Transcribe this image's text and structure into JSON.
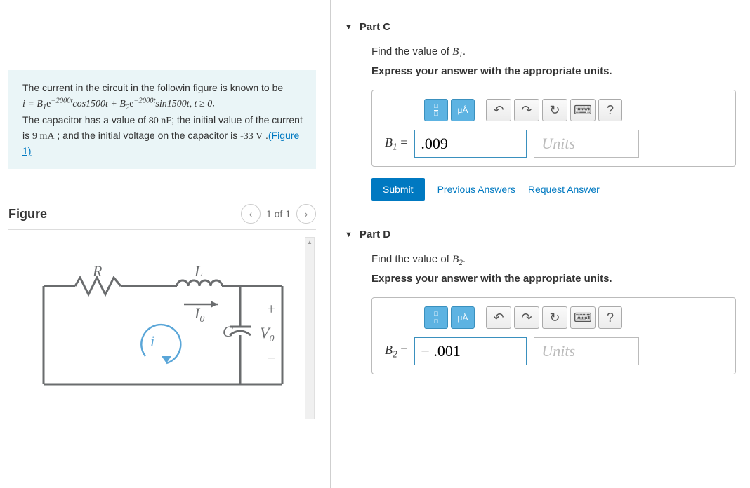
{
  "problem": {
    "intro": "The current in the circuit in the followin figure is known to be",
    "eq_prefix": "i = B",
    "eq_sub1": "1",
    "eq_exp1": "−2000t",
    "eq_cos": "cos1500t + B",
    "eq_sub2": "2",
    "eq_exp2": "−2000t",
    "eq_sin": "sin1500t, t ≥ 0",
    "line2_a": "The capacitor has a value of ",
    "cap_val": "80 nF",
    "line2_b": "; the initial value of the current is ",
    "cur_val": "9 mA",
    "line2_c": " ; and the initial voltage on the capacitor is ",
    "volt_val": "-33 V",
    "line2_d": " .",
    "figure_link": "(Figure 1)"
  },
  "figure": {
    "title": "Figure",
    "nav_text": "1 of 1",
    "labels": {
      "R": "R",
      "L": "L",
      "I0": "I",
      "i": "i",
      "C": "C",
      "V0": "V",
      "plus": "+",
      "minus": "−",
      "zero": "0"
    }
  },
  "partC": {
    "title": "Part C",
    "prompt_a": "Find the value of ",
    "prompt_var": "B",
    "prompt_sub": "1",
    "prompt_b": ".",
    "instruct": "Express your answer with the appropriate units.",
    "var_label_a": "B",
    "var_label_sub": "1",
    "var_label_eq": " = ",
    "value": ".009",
    "units_placeholder": "Units",
    "toolbar": {
      "units": "μÅ",
      "undo": "↶",
      "redo": "↷",
      "reset": "↻",
      "keyboard": "⌨",
      "help": "?"
    },
    "submit": "Submit",
    "prev": "Previous Answers",
    "req": "Request Answer"
  },
  "partD": {
    "title": "Part D",
    "prompt_a": "Find the value of ",
    "prompt_var": "B",
    "prompt_sub": "2",
    "prompt_b": ".",
    "instruct": "Express your answer with the appropriate units.",
    "var_label_a": "B",
    "var_label_sub": "2",
    "var_label_eq": " = ",
    "value": "− .001",
    "units_placeholder": "Units",
    "toolbar": {
      "units": "μÅ",
      "undo": "↶",
      "redo": "↷",
      "reset": "↻",
      "keyboard": "⌨",
      "help": "?"
    }
  }
}
